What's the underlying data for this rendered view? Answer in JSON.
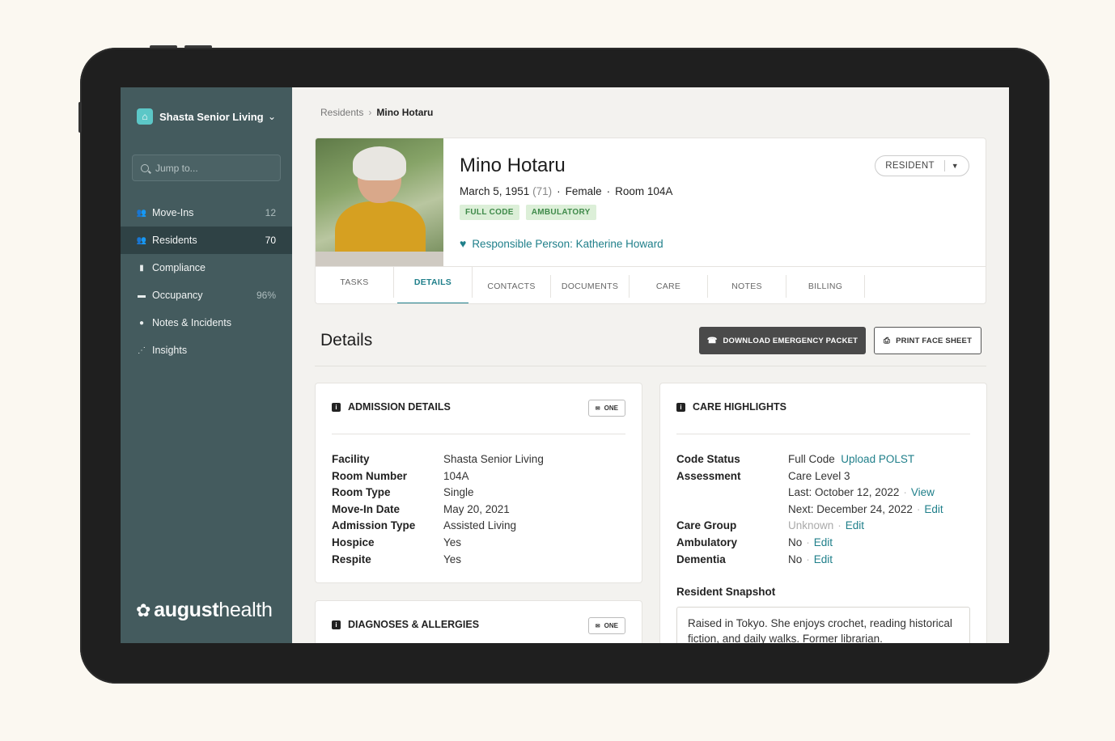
{
  "sidebar": {
    "org_name": "Shasta Senior Living",
    "search_placeholder": "Jump to...",
    "items": [
      {
        "label": "Move-Ins",
        "count": "12",
        "icon": "group-icon"
      },
      {
        "label": "Residents",
        "count": "70",
        "icon": "people-icon"
      },
      {
        "label": "Compliance",
        "count": "",
        "icon": "clipboard-icon"
      },
      {
        "label": "Occupancy",
        "count": "96%",
        "icon": "bed-icon"
      },
      {
        "label": "Notes & Incidents",
        "count": "",
        "icon": "notes-icon"
      },
      {
        "label": "Insights",
        "count": "",
        "icon": "chart-icon"
      }
    ],
    "logo_bold": "august",
    "logo_light": "health"
  },
  "breadcrumb": {
    "parent": "Residents",
    "current": "Mino Hotaru"
  },
  "profile": {
    "name": "Mino Hotaru",
    "dob": "March 5, 1951",
    "age": "(71)",
    "gender": "Female",
    "room": "Room 104A",
    "tags": [
      "FULL CODE",
      "AMBULATORY"
    ],
    "responsible": "Responsible Person: Katherine Howard",
    "role": "RESIDENT"
  },
  "tabs": [
    "TASKS",
    "DETAILS",
    "CONTACTS",
    "DOCUMENTS",
    "CARE",
    "NOTES",
    "BILLING"
  ],
  "section": {
    "title": "Details",
    "download_label": "DOWNLOAD EMERGENCY PACKET",
    "print_label": "PRINT FACE SHEET"
  },
  "admission": {
    "title": "ADMISSION DETAILS",
    "one_label": "ONE",
    "rows": [
      {
        "k": "Facility",
        "v": "Shasta Senior Living"
      },
      {
        "k": "Room Number",
        "v": "104A"
      },
      {
        "k": "Room Type",
        "v": "Single"
      },
      {
        "k": "Move-In Date",
        "v": "May 20, 2021"
      },
      {
        "k": "Admission Type",
        "v": "Assisted Living"
      },
      {
        "k": "Hospice",
        "v": "Yes"
      },
      {
        "k": "Respite",
        "v": "Yes"
      }
    ]
  },
  "diagnoses": {
    "title": "DIAGNOSES & ALLERGIES",
    "one_label": "ONE"
  },
  "care": {
    "title": "CARE HIGHLIGHTS",
    "code_status_k": "Code Status",
    "code_status_v": "Full Code",
    "upload_link": "Upload POLST",
    "assessment_k": "Assessment",
    "assessment_v": "Care Level 3",
    "last": "Last: October 12, 2022",
    "view_link": "View",
    "next": "Next: December 24, 2022",
    "edit_link": "Edit",
    "care_group_k": "Care Group",
    "care_group_v": "Unknown",
    "ambulatory_k": "Ambulatory",
    "ambulatory_v": "No",
    "dementia_k": "Dementia",
    "dementia_v": "No",
    "snapshot_title": "Resident Snapshot",
    "snapshot_text": "Raised in Tokyo. She enjoys crochet, reading historical fiction, and daily walks. Former librarian."
  }
}
